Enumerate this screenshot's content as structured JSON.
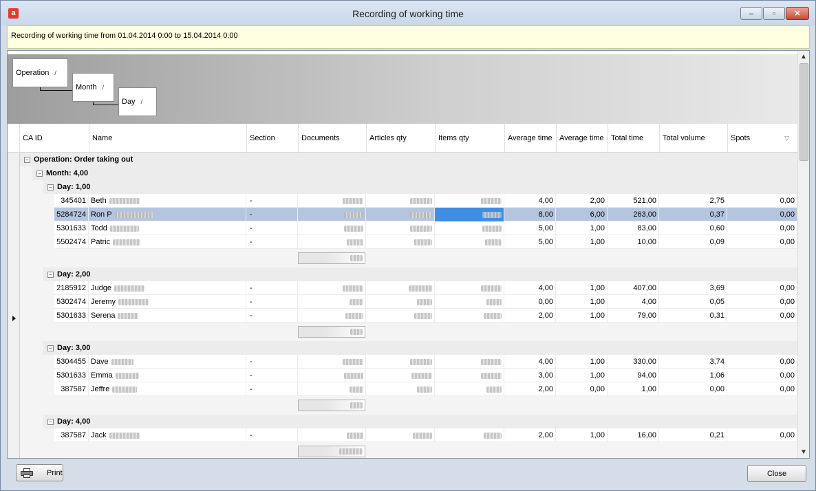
{
  "window": {
    "title": "Recording of working time",
    "app_icon": "a",
    "minimize": "–",
    "maximize": "▫",
    "close": "✕"
  },
  "info": {
    "text": "Recording of working time from 01.04.2014 0:00 to 15.04.2014 0:00"
  },
  "grouping": {
    "operation": "Operation",
    "month": "Month",
    "day": "Day",
    "sort_glyph": "/"
  },
  "columns": {
    "ca_id": "CA ID",
    "name": "Name",
    "section": "Section",
    "documents": "Documents",
    "articles_qty": "Articles qty",
    "items_qty": "Items qty",
    "avg_time_1": "Average time",
    "avg_time_2": "Average time",
    "total_time": "Total time",
    "total_volume": "Total volume",
    "spots": "Spots",
    "filter_glyph": "▽"
  },
  "groups": {
    "operation": "Operation: Order taking out",
    "month": "Month: 4,00",
    "day1": "Day: 1,00",
    "day2": "Day: 2,00",
    "day3": "Day: 3,00",
    "day4": "Day: 4,00"
  },
  "rows": [
    {
      "id": "345401",
      "name": "Beth",
      "section": "-",
      "avg1": "4,00",
      "avg2": "2,00",
      "total_time": "521,00",
      "total_volume": "2,75",
      "spots": "0,00"
    },
    {
      "id": "5284724",
      "name": "Ron P",
      "section": "-",
      "avg1": "8,00",
      "avg2": "6,00",
      "total_time": "263,00",
      "total_volume": "0,37",
      "spots": "0,00"
    },
    {
      "id": "5301633",
      "name": "Todd",
      "section": "-",
      "avg1": "5,00",
      "avg2": "1,00",
      "total_time": "83,00",
      "total_volume": "0,60",
      "spots": "0,00"
    },
    {
      "id": "5502474",
      "name": "Patric",
      "section": "-",
      "avg1": "5,00",
      "avg2": "1,00",
      "total_time": "10,00",
      "total_volume": "0,09",
      "spots": "0,00"
    },
    {
      "id": "2185912",
      "name": "Judge",
      "section": "-",
      "avg1": "4,00",
      "avg2": "1,00",
      "total_time": "407,00",
      "total_volume": "3,69",
      "spots": "0,00"
    },
    {
      "id": "5302474",
      "name": "Jeremy",
      "section": "-",
      "avg1": "0,00",
      "avg2": "1,00",
      "total_time": "4,00",
      "total_volume": "0,05",
      "spots": "0,00"
    },
    {
      "id": "5301633",
      "name": "Serena",
      "section": "-",
      "avg1": "2,00",
      "avg2": "1,00",
      "total_time": "79,00",
      "total_volume": "0,31",
      "spots": "0,00"
    },
    {
      "id": "5304455",
      "name": "Dave",
      "section": "-",
      "avg1": "4,00",
      "avg2": "1,00",
      "total_time": "330,00",
      "total_volume": "3,74",
      "spots": "0,00"
    },
    {
      "id": "5301633",
      "name": "Emma",
      "section": "-",
      "avg1": "3,00",
      "avg2": "1,00",
      "total_time": "94,00",
      "total_volume": "1,06",
      "spots": "0,00"
    },
    {
      "id": "387587",
      "name": "Jeffre",
      "section": "-",
      "avg1": "2,00",
      "avg2": "0,00",
      "total_time": "1,00",
      "total_volume": "0,00",
      "spots": "0,00"
    },
    {
      "id": "387587",
      "name": "Jack",
      "section": "-",
      "avg1": "2,00",
      "avg2": "1,00",
      "total_time": "16,00",
      "total_volume": "0,21",
      "spots": "0,00"
    }
  ],
  "buttons": {
    "print": "Print",
    "close": "Close"
  },
  "scroll": {
    "up": "▲",
    "down": "▼"
  }
}
